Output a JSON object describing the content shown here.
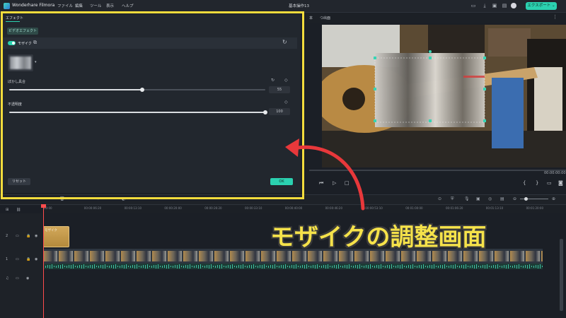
{
  "app": {
    "name": "Wonderhare Filmora",
    "project_title": "基本操作13"
  },
  "menu": [
    {
      "label": "ファイル"
    },
    {
      "label": "編集"
    },
    {
      "label": "ツール"
    },
    {
      "label": "表示"
    },
    {
      "label": "ヘルプ"
    }
  ],
  "export_button": "エクスポート ⌄",
  "effect_panel": {
    "tab": "エフェクト",
    "video_effect_button": "ビデオエフェクト",
    "effect_name": "モザイク",
    "params": [
      {
        "label": "ぼかし具合",
        "value": "55",
        "level_percent": 52
      },
      {
        "label": "不透明度",
        "value": "100",
        "level_percent": 100
      }
    ],
    "reset_button": "リセット",
    "ok_button": "OK"
  },
  "preview": {
    "tab1": "本",
    "tab2": "つ出面",
    "timecode": "00:00:00:00"
  },
  "timeline": {
    "ruler_labels": [
      "00:00",
      "00:00:06:20",
      "00:00:13:10",
      "00:00:20:00",
      "00:00:26:20",
      "00:00:33:10",
      "00:00:40:00",
      "00:00:46:20",
      "00:00:53:10",
      "00:01:00:00",
      "00:01:06:20",
      "00:01:13:10",
      "00:01:20:00",
      "00:01:26:20"
    ],
    "effect_clip_label": "モザイク",
    "track_numbers": [
      "2",
      "1",
      "1"
    ]
  },
  "annotation": {
    "caption": "モザイクの調整画面",
    "frame_color": "#f3dc3c"
  },
  "colors": {
    "accent": "#2bd1b0",
    "playhead": "#ff4d4d",
    "caption": "#f5e24a"
  },
  "icons": [
    "app-logo-icon",
    "copy-icon",
    "reset-icon",
    "keyframe-icon",
    "play-icon",
    "stop-icon",
    "prev-frame-icon",
    "fullscreen-icon",
    "eye-icon",
    "lock-icon",
    "music-icon"
  ]
}
